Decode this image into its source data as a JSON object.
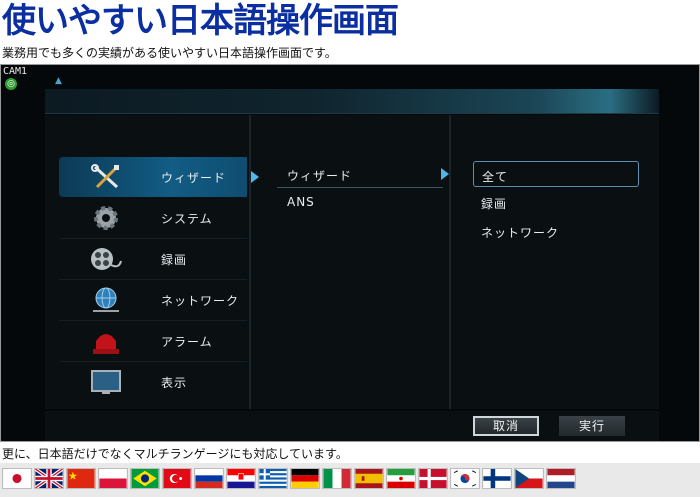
{
  "header": {
    "title": "使いやすい日本語操作画面",
    "subtitle": "業務用でも多くの実績がある使いやすい日本語操作画面です。"
  },
  "dvr": {
    "camera_label": "CAM1",
    "main_menu": [
      {
        "label": "ウィザード",
        "icon": "tools-icon",
        "active": true
      },
      {
        "label": "システム",
        "icon": "gear-icon",
        "active": false
      },
      {
        "label": "録画",
        "icon": "film-reel-icon",
        "active": false
      },
      {
        "label": "ネットワーク",
        "icon": "globe-network-icon",
        "active": false
      },
      {
        "label": "アラーム",
        "icon": "alarm-light-icon",
        "active": false
      },
      {
        "label": "表示",
        "icon": "monitor-icon",
        "active": false
      }
    ],
    "sub_menu": [
      {
        "label": "ウィザード",
        "active": true
      },
      {
        "label": "ANS",
        "active": false
      }
    ],
    "options": [
      {
        "label": "全て",
        "selected": true
      },
      {
        "label": "録画",
        "selected": false
      },
      {
        "label": "ネットワーク",
        "selected": false
      }
    ],
    "buttons": {
      "cancel": "取消",
      "execute": "実行"
    }
  },
  "footer": {
    "text": "更に、日本語だけでなくマルチランゲージにも対応しています。"
  },
  "languages": [
    "japan-flag",
    "uk-flag",
    "china-flag",
    "poland-flag",
    "brazil-flag",
    "turkey-flag",
    "russia-flag",
    "croatia-flag",
    "greece-flag",
    "germany-flag",
    "italy-flag",
    "spain-flag",
    "iran-flag",
    "denmark-flag",
    "korea-flag",
    "finland-flag",
    "czech-flag",
    "netherlands-flag"
  ],
  "colors": {
    "headline": "#0b2fa0",
    "active_item": "#125c85",
    "arrow": "#4fb6e6"
  }
}
